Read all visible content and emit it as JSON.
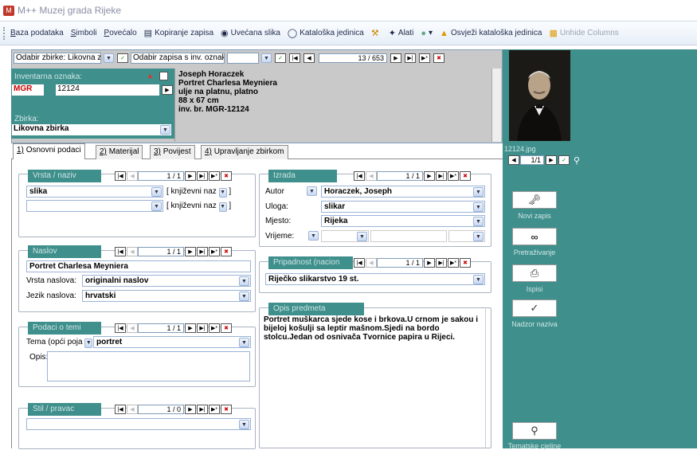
{
  "window": {
    "title": "M++ Muzej grada Rijeke"
  },
  "toolbar": {
    "items": [
      {
        "label": "Baza podataka",
        "icon": "",
        "underline": "B",
        "rest": "aza podataka"
      },
      {
        "label": "Simboli",
        "icon": "",
        "underline": "S",
        "rest": "imboli"
      },
      {
        "label": "Povećalo",
        "icon": "",
        "underline": "P",
        "rest": "ovećalo"
      },
      {
        "label": "Kopiranje zapisa",
        "icon": "copy-icon"
      },
      {
        "label": "Uvećana slika",
        "icon": "eye-icon"
      },
      {
        "label": "Kataloška jedinica",
        "icon": "speech-icon"
      },
      {
        "label": "",
        "icon": "tools-icon"
      },
      {
        "label": "Alati",
        "icon": "wand-icon"
      },
      {
        "label": "",
        "icon": "help-icon"
      },
      {
        "label": "Osvježi kataloška jedinica",
        "icon": "refresh-icon"
      },
      {
        "label": "Unhide Columns",
        "icon": "columns-icon"
      }
    ],
    "save_label": ""
  },
  "header": {
    "odabir_zbirke_label": "Odabir zbirke:",
    "odabir_zbirke_value": "Likovna zbirka",
    "odabir_zapisa_label": "Odabir zapisa s inv. oznakom",
    "record_counter": "13 / 653",
    "inventarna_label": "Inventarna oznaka:",
    "inv_prefix": "MGR",
    "inv_number": "12124",
    "zbirka_label": "Zbirka:",
    "zbirka_value": "Likovna zbirka",
    "description": [
      "Joseph Horaczek",
      "Portret Charlesa Meyniera",
      "ulje na platnu, platno",
      "88 x 67 cm",
      "inv. br. MGR-12124"
    ]
  },
  "tabs": [
    {
      "num": "1)",
      "label": "Osnovni podaci"
    },
    {
      "num": "2)",
      "label": "Materijal"
    },
    {
      "num": "3)",
      "label": "Povijest"
    },
    {
      "num": "4)",
      "label": "Upravljanje zbirkom"
    }
  ],
  "groups": {
    "vrsta": {
      "title": "Vrsta / naziv",
      "counter": "1 / 1",
      "row1": "slika",
      "row1_extra": "[ književni naz",
      "row2_extra": "[ književni naz"
    },
    "naslov": {
      "title": "Naslov",
      "counter": "1 / 1",
      "value": "Portret Charlesa Meyniera",
      "vrsta_label": "Vrsta naslova:",
      "vrsta_value": "originalni naslov",
      "jezik_label": "Jezik naslova:",
      "jezik_value": "hrvatski"
    },
    "podaci": {
      "title": "Podaci o temi",
      "counter": "1 / 1",
      "tema_label": "Tema (opći poja",
      "tema_value": "portret",
      "opis_label": "Opis:"
    },
    "stil": {
      "title": "Stil / pravac",
      "counter": "1 / 0"
    },
    "izrada": {
      "title": "Izrada",
      "counter": "1 / 1",
      "autor_label": "Autor",
      "autor_value": "Horaczek, Joseph",
      "uloga_label": "Uloga:",
      "uloga_value": "slikar",
      "mjesto_label": "Mjesto:",
      "mjesto_value": "Rijeka",
      "vrijeme_label": "Vrijeme:"
    },
    "pripadnost": {
      "title": "Pripadnost (nacion",
      "counter": "1 / 1",
      "value": "Riječko slikarstvo 19 st."
    },
    "opis": {
      "title": "Opis predmeta",
      "text": "Portret muškarca sjede kose i brkova.U crnom je sakou i bijeloj košulji sa leptir mašnom.Sjedi na bordo stolcu.Jedan od osnivača Tvornice papira u Rijeci."
    }
  },
  "side": {
    "image_name": "12124.jpg",
    "image_counter": "1/1",
    "buttons": [
      {
        "label": "Novi zapis",
        "icon": "new-record-icon"
      },
      {
        "label": "Pretraživanje",
        "icon": "binoculars-icon"
      },
      {
        "label": "Ispisi",
        "icon": "print-icon"
      },
      {
        "label": "Nadzor naziva",
        "icon": "spellcheck-icon"
      },
      {
        "label": "Tematske cjeline",
        "icon": "search-icon"
      }
    ]
  },
  "colors": {
    "teal": "#3f8f8c",
    "gray": "#c9c9c9",
    "border": "#7f9db9"
  }
}
